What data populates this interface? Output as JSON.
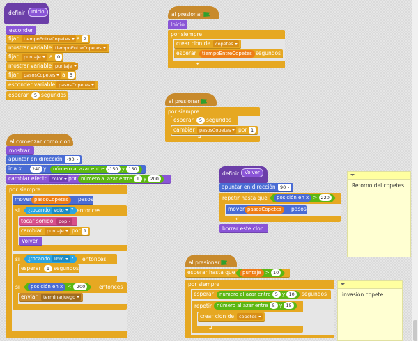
{
  "colors": {
    "purple": "#8a55d7",
    "orange": "#e6a822",
    "cat_orange": "#d8861d",
    "yellow": "#c88a2c",
    "blue": "#4a6cd4",
    "green": "#5cb712",
    "cyan": "#2ca5e2",
    "brown": "#9a6a2c",
    "red": "#e94d2c",
    "pink": "#d84f8a"
  },
  "s1": {
    "def": "definir",
    "name": "Inicio",
    "esconder": "esconder",
    "fijar": "fijar",
    "var1": "tiempoEntreCopetes",
    "a": "a",
    "v2": "2",
    "mostrar_var": "mostrar variable",
    "var_puntaje": "puntaje",
    "v0": "0",
    "var_pasos": "pasosCopetes",
    "v5": "5",
    "esconder_var": "esconder variable",
    "esperar": "esperar",
    "segundos": "segundos"
  },
  "s2": {
    "hat": "al presionar",
    "inicio": "Inicio",
    "forever": "por siempre",
    "clone": "crear clon de",
    "copetes": "copetes",
    "wait": "esperar",
    "segundos": "segundos",
    "var": "tiempoEntreCopetes"
  },
  "s3": {
    "hat": "al presionar",
    "forever": "por siempre",
    "wait": "esperar",
    "v5": "5",
    "segundos": "segundos",
    "change": "cambiar",
    "var": "pasosCopetes",
    "por": "por",
    "v1": "1"
  },
  "s4": {
    "hat": "al comenzar como clon",
    "mostrar": "mostrar",
    "point": "apuntar en dirección",
    "dir": "-90",
    "goto": "ir a x:",
    "x": "240",
    "y": "y:",
    "rand": "número al azar entre",
    "r1": "-150",
    "y_": "y",
    "r2": "150",
    "effect": "cambiar efecto",
    "color": "color",
    "por": "por",
    "e1": "1",
    "e2": "200",
    "forever": "por siempre",
    "move": "mover",
    "pasos": "pasos",
    "si": "si",
    "touching": "¿tocando",
    "voto": "voto",
    "q": "?",
    "entonces": "entonces",
    "sound": "tocar sonido",
    "pop": "pop",
    "change": "cambiar",
    "puntaje": "puntaje",
    "one": "1",
    "volver": "Volver",
    "libro": "libro",
    "wait": "esperar",
    "segundos": "segundos",
    "posx": "posición en x",
    "lt": "<",
    "m200": "-200",
    "send": "enviar",
    "game": "terminarJuego"
  },
  "s5": {
    "def": "definir",
    "name": "Volver",
    "point": "apuntar en dirección",
    "dir": "90",
    "until": "repetir hasta que",
    "posx": "posición en x",
    "gt": ">",
    "v220": "220",
    "move": "mover",
    "pasos": "pasosCopetes",
    "pasos_label": "pasos",
    "delete": "borrar este clon"
  },
  "s6": {
    "hat": "al presionar",
    "wait_until": "esperar hasta que",
    "puntaje": "puntaje",
    "gt": ">",
    "v10": "10",
    "forever": "por siempre",
    "wait": "esperar",
    "rand": "número al azar entre",
    "r5": "5",
    "y": "y",
    "r10": "10",
    "segundos": "segundos",
    "repeat": "repetir",
    "r15": "15",
    "clone": "crear clon de",
    "copetes": "copetes"
  },
  "notes": {
    "n1": "Retorno del copetes",
    "n2": "invasión copete"
  }
}
